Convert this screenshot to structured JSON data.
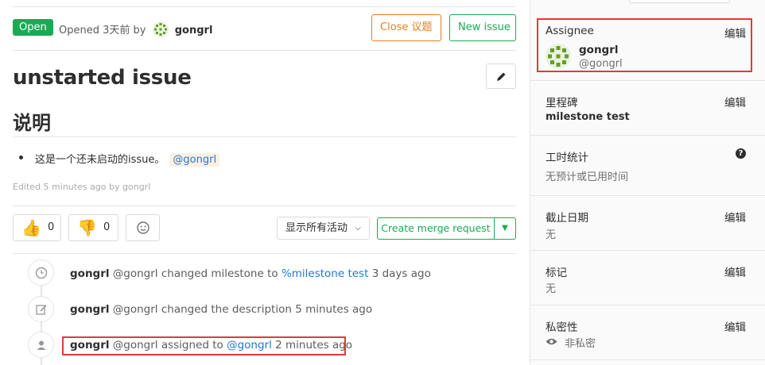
{
  "issue": {
    "status": "Open",
    "opened_prefix": "Opened 3天前 by",
    "author": "gongrl",
    "close_label": "Close 议题",
    "new_issue_label": "New issue",
    "title": "unstarted issue",
    "description_heading": "说明",
    "description_text": "这是一个还未启动的issue。",
    "description_mention": "@gongrl",
    "edited_text": "Edited 5 minutes ago by gongrl"
  },
  "awards": {
    "thumbs_up_count": "0",
    "thumbs_down_count": "0"
  },
  "activity": {
    "filter_label": "显示所有活动",
    "create_mr_label": "Create merge request"
  },
  "timeline": [
    {
      "icon": "clock-icon",
      "who": "gongrl",
      "text": "@gongrl changed milestone to",
      "link": "%milestone test",
      "time": "3 days ago"
    },
    {
      "icon": "pencil-square-icon",
      "who": "gongrl",
      "text": "@gongrl changed the description",
      "link": "",
      "time": "5 minutes ago"
    },
    {
      "icon": "user-icon",
      "who": "gongrl",
      "text": "@gongrl assigned to",
      "link": "@gongrl",
      "time": "2 minutes ago"
    }
  ],
  "sidebar": {
    "edit_label": "编辑",
    "assignee": {
      "title": "Assignee",
      "name": "gongrl",
      "username": "@gongrl"
    },
    "milestone": {
      "title": "里程碑",
      "value": "milestone test"
    },
    "time_tracking": {
      "title": "工时统计",
      "value": "无预计或已用时间"
    },
    "due_date": {
      "title": "截止日期",
      "value": "无"
    },
    "labels": {
      "title": "标记",
      "value": "无"
    },
    "confidentiality": {
      "title": "私密性",
      "value": "非私密"
    }
  },
  "colors": {
    "open_green": "#1aaa55",
    "close_orange": "#e67e22",
    "link_blue": "#1f78d1",
    "highlight_red": "#e03a3a"
  }
}
